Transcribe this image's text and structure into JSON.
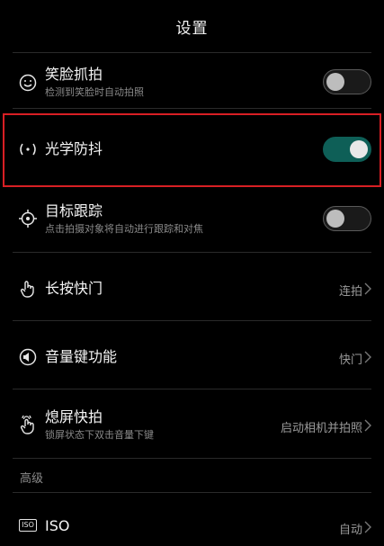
{
  "header": {
    "title": "设置"
  },
  "rows": {
    "smile": {
      "label": "笑脸抓拍",
      "sub": "检测到笑脸时自动拍照",
      "on": false
    },
    "ois": {
      "label": "光学防抖",
      "on": true
    },
    "track": {
      "label": "目标跟踪",
      "sub": "点击拍摄对象将自动进行跟踪和对焦",
      "on": false
    },
    "longpress": {
      "label": "长按快门",
      "value": "连拍"
    },
    "volume": {
      "label": "音量键功能",
      "value": "快门"
    },
    "snapshot": {
      "label": "熄屏快拍",
      "sub": "锁屏状态下双击音量下键",
      "value": "启动相机并拍照"
    }
  },
  "section": {
    "advanced": "高级"
  },
  "iso": {
    "icon_text": "ISO",
    "label": "ISO",
    "value": "自动"
  },
  "colors": {
    "toggle_on": "#0e5f57",
    "highlight": "#d81f24"
  },
  "icons": [
    "smile-icon",
    "stabilize-icon",
    "target-icon",
    "hand-tap-icon",
    "volume-key-icon",
    "hand-double-tap-icon",
    "iso-icon",
    "chevron-right-icon"
  ]
}
